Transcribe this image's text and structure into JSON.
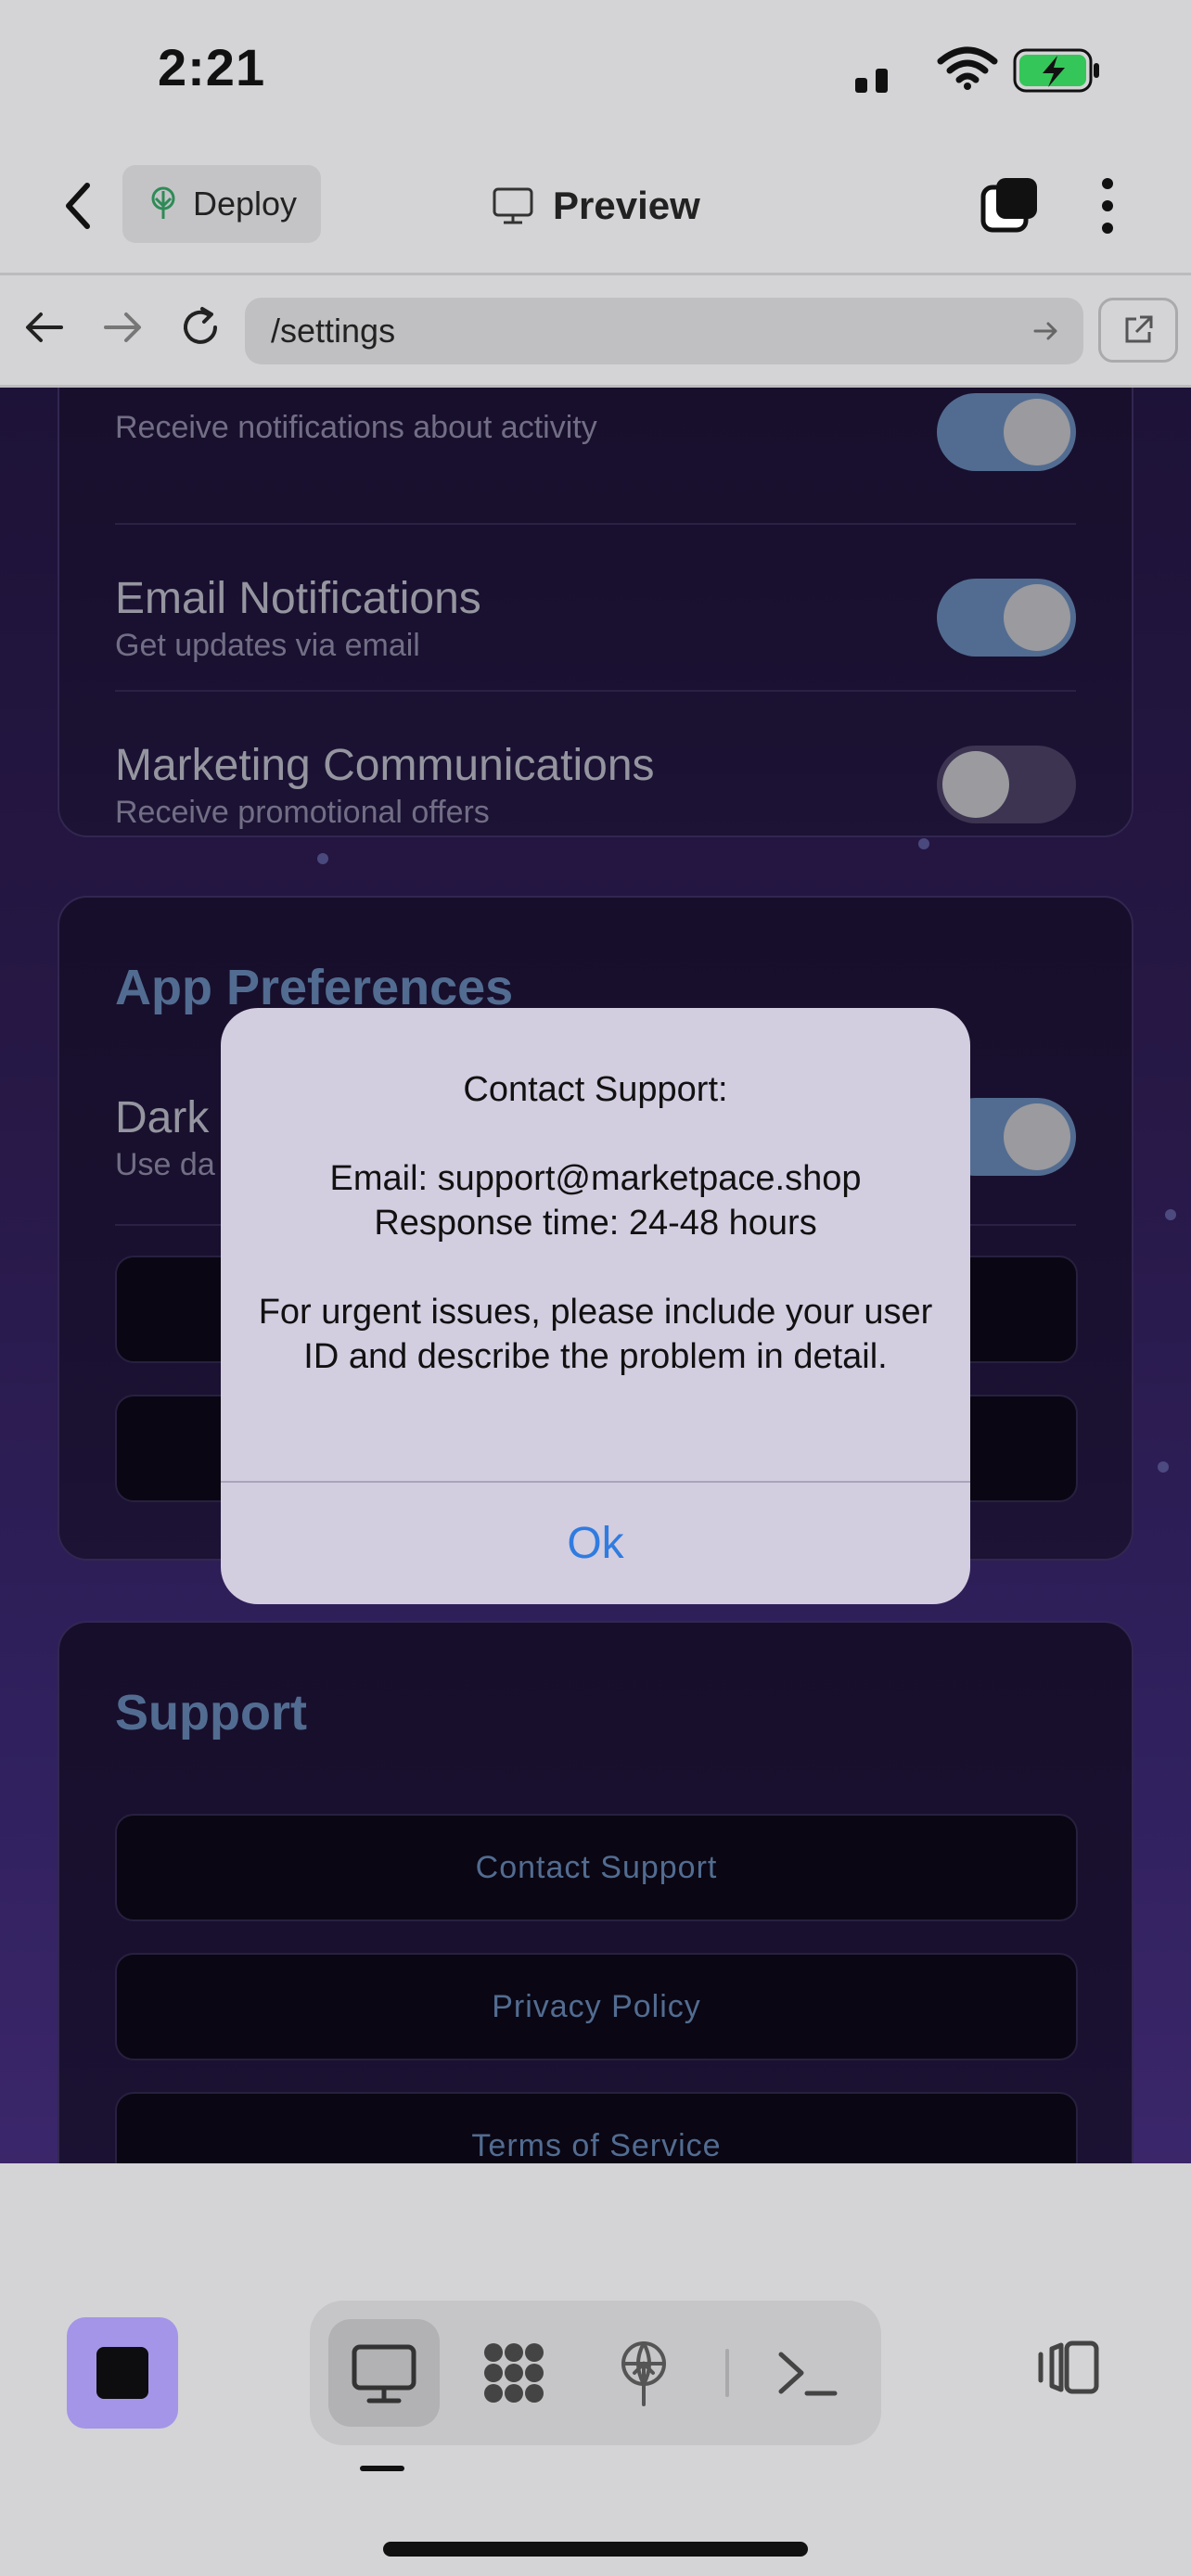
{
  "status_bar": {
    "time": "2:21"
  },
  "app_header": {
    "deploy_label": "Deploy",
    "title": "Preview"
  },
  "browser": {
    "url": "/settings"
  },
  "notifications": {
    "rows": [
      {
        "title": "",
        "subtitle": "Receive notifications about activity",
        "enabled": true
      },
      {
        "title": "Email Notifications",
        "subtitle": "Get updates via email",
        "enabled": true
      },
      {
        "title": "Marketing Communications",
        "subtitle": "Receive promotional offers",
        "enabled": false
      }
    ]
  },
  "app_preferences": {
    "title": "App Preferences",
    "dark_mode_title": "Dark",
    "dark_mode_subtitle": "Use da",
    "dark_mode_enabled": true
  },
  "support": {
    "title": "Support",
    "buttons": [
      "Contact Support",
      "Privacy Policy",
      "Terms of Service"
    ]
  },
  "alert": {
    "heading": "Contact Support:",
    "email_line": "Email: support@marketpace.shop",
    "response_line": "Response time: 24-48 hours",
    "urgent_line": "For urgent issues, please include your user ID and describe the problem in detail.",
    "ok_label": "Ok"
  },
  "colors": {
    "accent": "#7aa0d6",
    "alert_button": "#2f7ce0",
    "stop_button": "#a495e8"
  },
  "icons": [
    "back-chevron-icon",
    "deploy-icon",
    "monitor-icon",
    "tabs-icon",
    "more-vertical-icon",
    "arrow-left-icon",
    "arrow-right-icon",
    "reload-icon",
    "open-external-icon",
    "stop-icon",
    "preview-monitor-icon",
    "network-icon",
    "deploy-globe-icon",
    "terminal-icon",
    "panel-toggle-icon"
  ]
}
